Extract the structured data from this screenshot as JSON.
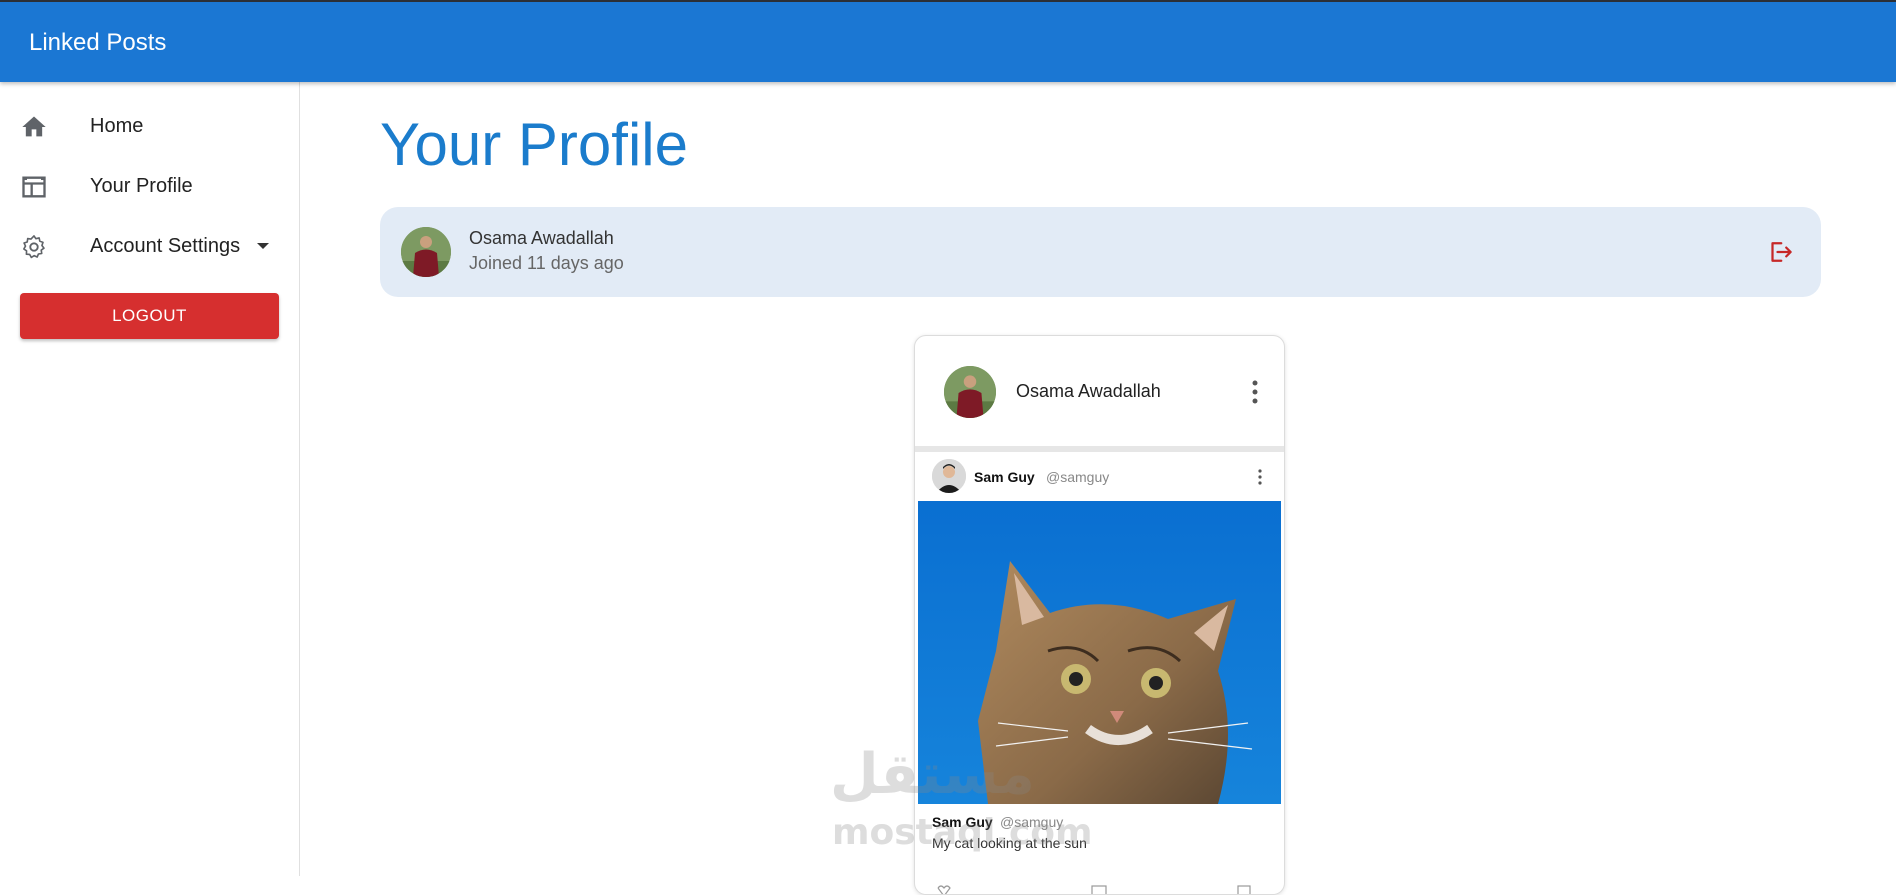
{
  "app": {
    "title": "Linked Posts",
    "accent": "#1b77d3"
  },
  "sidebar": {
    "items": [
      {
        "label": "Home",
        "icon": "home-icon"
      },
      {
        "label": "Your Profile",
        "icon": "table-layout-icon"
      },
      {
        "label": "Account Settings",
        "icon": "gear-icon"
      }
    ],
    "logout_label": "LOGOUT",
    "logout_color": "#d62f2f"
  },
  "main": {
    "title": "Your Profile",
    "profile": {
      "name": "Osama Awadallah",
      "joined": "Joined 11 days ago"
    },
    "post": {
      "author": "Osama Awadallah",
      "embed": {
        "name": "Sam Guy",
        "handle": "@samguy",
        "caption": "My cat looking at the sun"
      }
    }
  },
  "watermark": {
    "arabic": "مستقل",
    "latin": "mostaql.com"
  }
}
